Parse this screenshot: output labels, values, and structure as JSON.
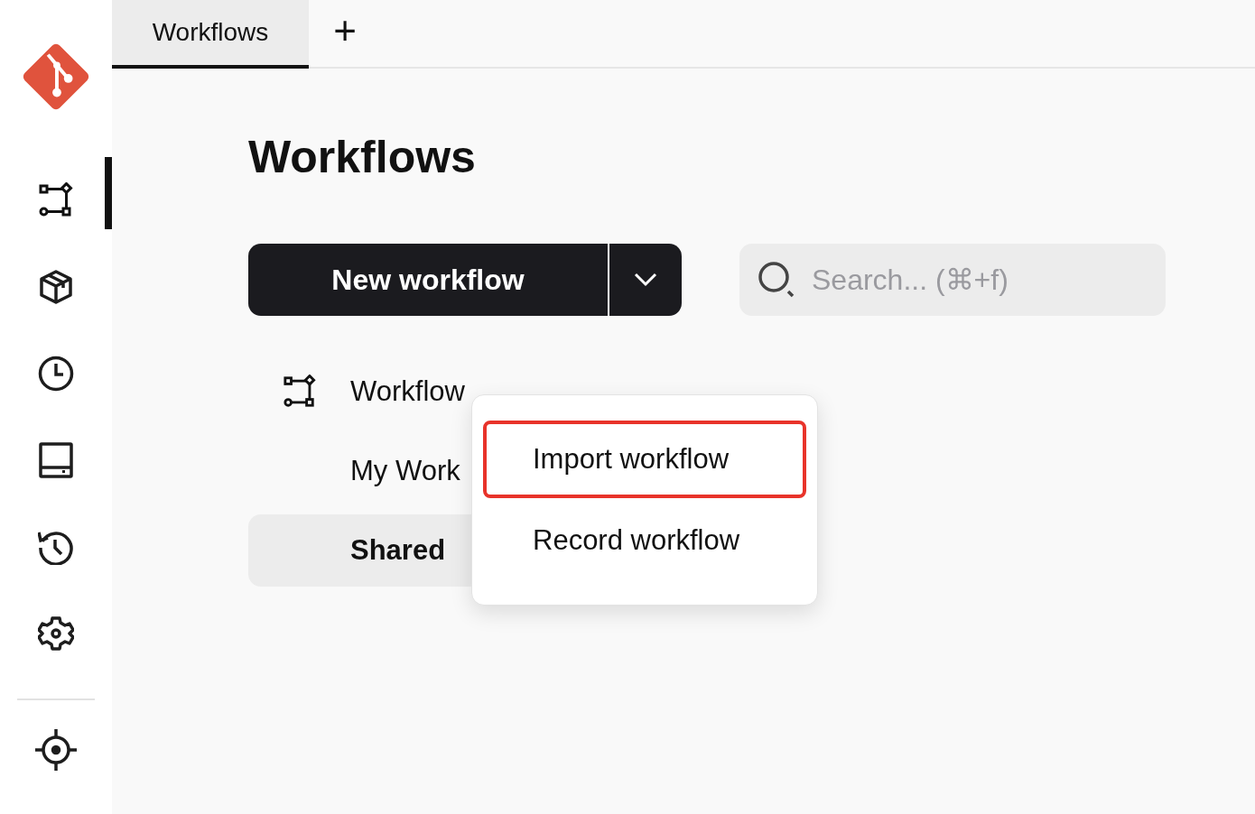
{
  "sidebar": {
    "items": [
      {
        "selected": true
      },
      {
        "selected": false
      },
      {
        "selected": false
      },
      {
        "selected": false
      },
      {
        "selected": false
      },
      {
        "selected": false
      },
      {
        "selected": false
      }
    ]
  },
  "tabs": [
    {
      "label": "Workflows",
      "selected": true
    }
  ],
  "new_tab_button": "+",
  "heading": "Workflows",
  "new_workflow_button": "New workflow",
  "search": {
    "placeholder": "Search... (⌘+f)"
  },
  "list": [
    {
      "kind": "header",
      "label": "Workflow",
      "selected": false
    },
    {
      "kind": "item",
      "label": "My Work",
      "selected": false
    },
    {
      "kind": "item",
      "label": "Shared",
      "selected": true
    }
  ],
  "menu": {
    "items": [
      {
        "label": "Import workflow",
        "highlighted": true
      },
      {
        "label": "Record workflow",
        "highlighted": false
      }
    ]
  }
}
